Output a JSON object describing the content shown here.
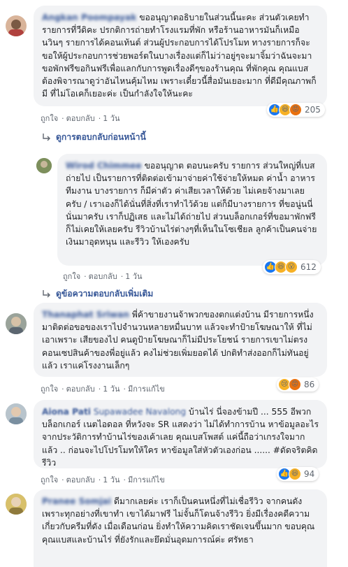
{
  "comments": [
    {
      "author": "Angkan Poompayak",
      "text": "ขออนุญาตอธิบายในส่วนนี้นะคะ ส่วนตัวเคยทำรายการที่วีดิคะ ปรกติการถ่ายทำโรงแรมที่พัก หรือร้านอาหารมันก็เหมือนวินๆ รายการได้คอนเท้นต์ ส่วนผู้ประกอบการได้โปรโมท ทางรายการก็จะขอให้ผู้ประกอบการช่วยพอร์ตในบางเรื่องแต่ก็ไม่ว่าอยู่ๆจะมาจิ้มว่าฉันจะมาขอพักฟรีขอกินฟรีเพื่อแลกกับการพูดเรื่องดีๆของร้านคุณ ที่พักคุณ คุณแบสต้องพิจารณาดูว่าอันไหนคุ้มไหม เพราะเดี๋ยวนี้สื่อมันเยอะมาก ที่ดีมีคุณภาพก็มี ที่ไม่โอเคก็เยอะค่ะ เป็นกำลังใจให้นะคะ",
      "like": "ถูกใจ",
      "reply": "ตอบกลับ",
      "time": "1 วัน",
      "reaction_count": "205"
    },
    {
      "author": "Wirod Chimmee",
      "text": "ขออนุญาต ตอบนะครับ รายการ ส่วนใหญ่ที่เบสถ่ายไป เป็นรายการที่ติดต่อเข้ามาจ่ายค่าใช้จ่ายให้หมด ค่าน้ำ อาหาร ทีมงาน บางรายการ ก็มีค่าตัว ค่าเสียเวลาให้ด้วย ไม่เคยจ้างมาเลยครับ / เราเองก็ได้นั่นที่สิ่งที่เราทำไว้ด้วย แต่ก็มีบางรายการ ที่ขอนู่นนี่นั่นมาครับ เราก็ปฏิเสธ และไม่ได้ถ่ายไป ส่วนบล็อกเกอร์ที่ขอมาพักฟรี ก็ไม่เคยให้เลยครับ รีวิวบ้านไร่ต่างๆที่เห็นในโซเชียล ลูกค้าเป็นคนจ่ายเงินมาอุดหนุน และรีวิว ให้เองครับ",
      "like": "ถูกใจ",
      "reply": "ตอบกลับ",
      "time": "1 วัน",
      "reaction_count": "612"
    },
    {
      "author": "Thanaphat Sriwan",
      "text": "พี่ค้าขายงานจ้าพวกของตกแต่งบ้าน มีรายการหนึ่งมาติดต่อขอของเราไปจำนวนหลายหมื่นบาท แล้วจะทำป้ายโฆษณาให้ ที่ไม่เอาเพราะ เสียของไป คนดูป้ายโฆษณาก็ไม่มีประโยชน์ รายการเขาไม่ตรงคอนเซปสินค้าของพี่อยู่แล้ว คงไม่ช่วยเพิ่มยอดได้ ปกติทำส่งออกก็ไม่ทันอยู่แล้ว เราแค่โรงงานเล็กๆ",
      "like": "ถูกใจ",
      "reply": "ตอบกลับ",
      "time": "1 วัน",
      "edited": "มีการแก้ไข",
      "reaction_count": "86"
    },
    {
      "author": "Aiona Pati",
      "tag": "Supawadee Navalong",
      "text": "บ้านไร่ นี่จองข้ามปี ... 555 อีพวกบล็อกเกอร์ เนตไอดอล ที่หวังจะ SR แสดงว่า ไม่ได้ทำการบ้าน หาข้อมูลอะไรจากประวัติการทำบ้านไร่ของเค้าเลย คุณเบสโพสต์ แค่นี้ถือว่าเกรงใจมากแล้ว .. ก่อนจะไปโปรโมทให้ใคร หาข้อมูลใส่หัวตัวเองก่อน ...... #ดัดจริตคิดรีวิว",
      "like": "ถูกใจ",
      "reply": "ตอบกลับ",
      "time": "1 วัน",
      "edited": "มีการแก้ไข",
      "reaction_count": "94"
    },
    {
      "author": "Pranee Somjai",
      "text": "ดีมากเลยค่ะ เราก็เป็นคนหนึ่งที่ไม่เชื่อรีวิว จากคนดัง เพราะทุกอย่างที่เขาทำ เขาได้มาฟรี ไม่จั้นก็โดนจ้างรีวิว ยิ่งมีเรื่องคดีความเกี่ยวกับครีมที่ดัง เมื่อเดือนก่อน ยิ่งทำให้ความคิดเราชัดเจนขึ้นมาก ขอบคุณคุณแบสและบ้านไร่ ที่ยังรักและยึดมั่นอุดมการณ์ค่ะ ศรัทธา"
    }
  ],
  "links": {
    "previous_replies": "ดูการตอบกลับก่อนหน้านี้",
    "more_replies": "ดูข้อความตอบกลับเพิ่มเติม"
  },
  "colors": {
    "link": "#385898",
    "bubble": "#f2f3f5",
    "like_blue": "#1877f2",
    "reaction_yellow": "#f7b125"
  }
}
